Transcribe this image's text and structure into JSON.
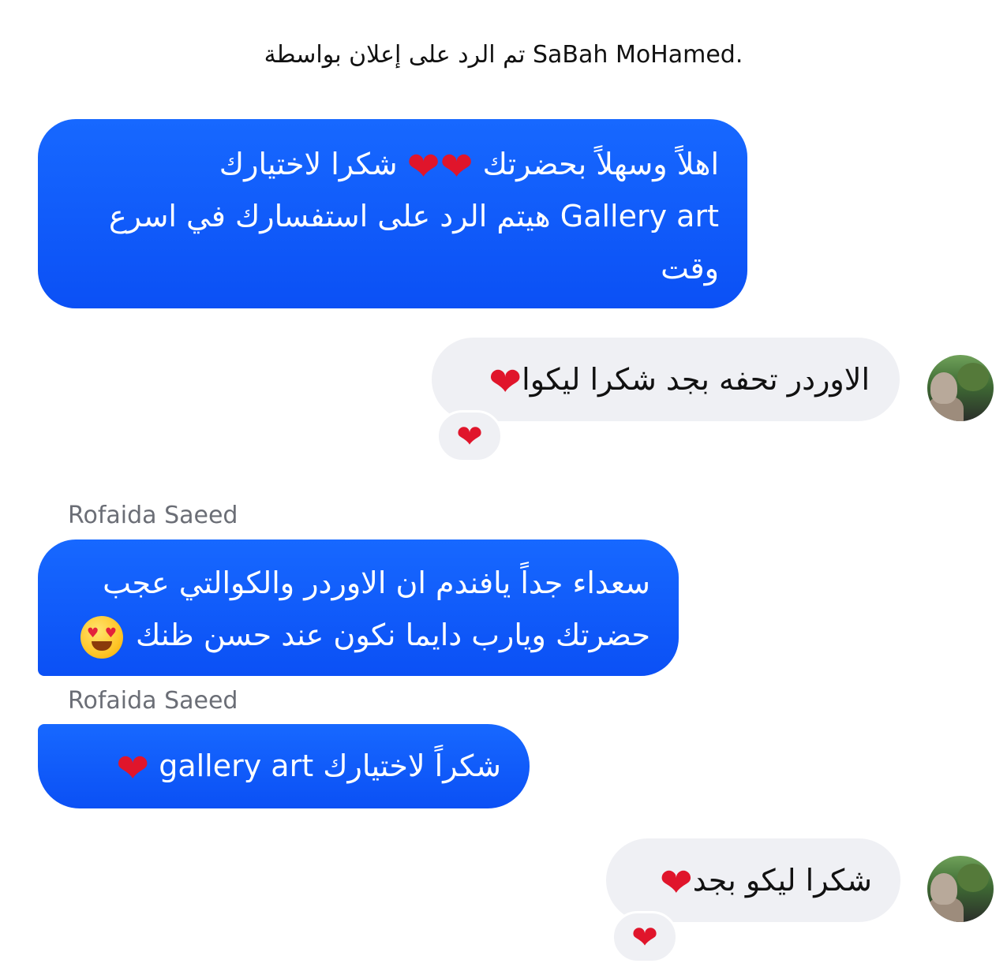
{
  "ad_notice": "تم الرد على إعلان بواسطة SaBah MoHamed.",
  "messages": [
    {
      "lines": [
        "اهلاً وسهلاً بحضرتك",
        "شكرا لاختيارك",
        "Gallery art",
        "هيتم الرد على استفسارك في اسرع",
        "وقت"
      ]
    },
    {
      "text": "الاوردر تحفه بجد شكرا ليكوا",
      "reaction": "heart"
    },
    {
      "sender": "Rofaida Saeed",
      "lines": [
        "سعداء جداً يافندم ان الاوردر والكوالتي عجب",
        "حضرتك ويارب دايما نكون عند حسن ظنك"
      ]
    },
    {
      "sender": "Rofaida Saeed",
      "text_ar": "شكراً لاختيارك",
      "text_en": "gallery art"
    },
    {
      "text": "شكرا ليكو بجد",
      "reaction": "heart"
    }
  ],
  "emoji": {
    "heart": "❤",
    "smiling_heart_eyes": "heart-eyes-emoji"
  },
  "colors": {
    "outgoing_bubble": "#0b5cff",
    "incoming_bubble": "#eff0f4",
    "sender_name": "#6b6e76"
  }
}
